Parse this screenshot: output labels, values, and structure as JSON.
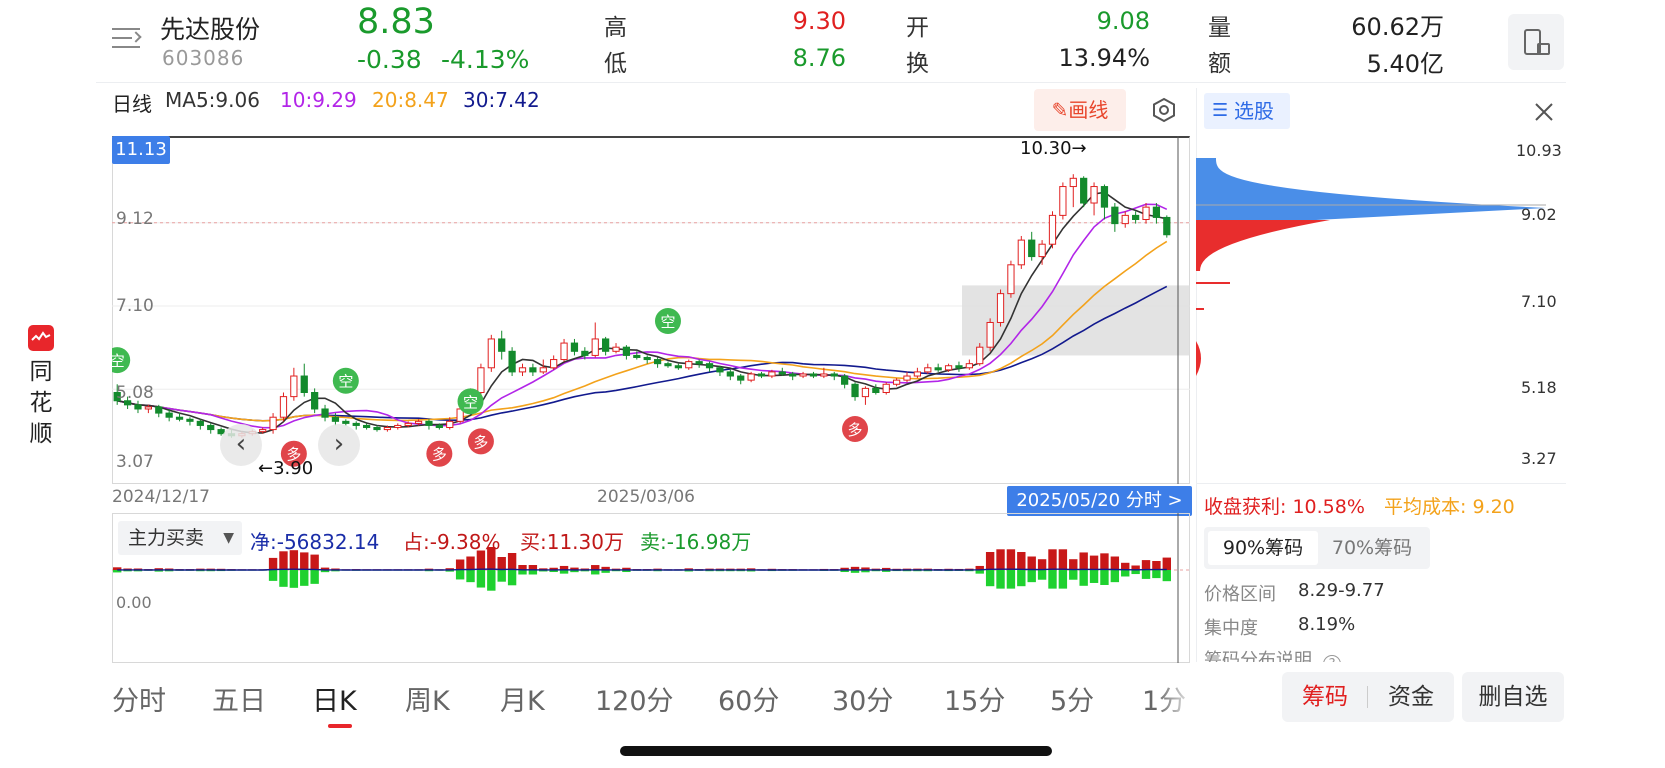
{
  "header": {
    "stock_name": "先达股份",
    "stock_code": "603086",
    "price": "8.83",
    "change": "-0.38",
    "change_pct": "-4.13%",
    "high_label": "高",
    "high_value": "9.30",
    "low_label": "低",
    "low_value": "8.76",
    "open_label": "开",
    "open_value": "9.08",
    "turnover_label": "换",
    "turnover_value": "13.94%",
    "volume_label": "量",
    "volume_value": "60.62万",
    "amount_label": "额",
    "amount_value": "5.40亿"
  },
  "brand": {
    "chars": [
      "同",
      "花",
      "顺"
    ]
  },
  "ma_bar": {
    "period": "日线",
    "ma5": "MA5:9.06",
    "ma10": "10:9.29",
    "ma20": "20:8.47",
    "ma30": "30:7.42",
    "draw_button": "画线"
  },
  "kline": {
    "top_price_tag": "11.13",
    "y_labels": [
      "9.12",
      "7.10",
      "5.08",
      "3.07"
    ],
    "x_dates": [
      "2024/12/17",
      "2025/03/06"
    ],
    "date_tag": "2025/05/20 分时 >",
    "high_annotation": "10.30→",
    "low_annotation": "←3.90",
    "signal_short": "空",
    "signal_long": "多",
    "colors": {
      "up": "#e02020",
      "down": "#138a2c",
      "ma5": "#333333",
      "ma10": "#b225e8",
      "ma20": "#f3a21b",
      "ma30": "#121a8e"
    }
  },
  "indicator": {
    "name": "主力买卖",
    "zero_label": "0.00",
    "net": "净:-56832.14",
    "share": "占:-9.38%",
    "buy": "买:11.30万",
    "sell": "卖:-16.98万"
  },
  "chip_panel": {
    "select_button": "选股",
    "price_labels": [
      "10.93",
      "9.02",
      "7.10",
      "5.18",
      "3.27"
    ],
    "profit_label": "收盘获利: 10.58%",
    "avg_cost_label": "平均成本: 9.20",
    "tab_90": "90%筹码",
    "tab_70": "70%筹码",
    "range_label": "价格区间",
    "range_value": "8.29-9.77",
    "concentration_label": "集中度",
    "concentration_value": "8.19%",
    "help_label": "筹码分布说明"
  },
  "periods": [
    "分时",
    "五日",
    "日K",
    "周K",
    "月K",
    "120分",
    "60分",
    "30分",
    "15分",
    "5分",
    "1分"
  ],
  "active_period": "日K",
  "bottom_buttons": {
    "chips": "筹码",
    "funds": "资金",
    "remove": "删自选"
  },
  "kline_data": {
    "ohlc": [
      [
        5.0,
        4.8,
        5.2,
        4.7
      ],
      [
        4.8,
        4.7,
        4.9,
        4.6
      ],
      [
        4.7,
        4.6,
        4.8,
        4.5
      ],
      [
        4.6,
        4.65,
        4.7,
        4.5
      ],
      [
        4.65,
        4.5,
        4.7,
        4.4
      ],
      [
        4.5,
        4.4,
        4.6,
        4.3
      ],
      [
        4.4,
        4.35,
        4.5,
        4.3
      ],
      [
        4.35,
        4.3,
        4.4,
        4.2
      ],
      [
        4.3,
        4.2,
        4.35,
        4.1
      ],
      [
        4.2,
        4.1,
        4.25,
        4.0
      ],
      [
        4.1,
        4.0,
        4.15,
        3.95
      ],
      [
        4.0,
        3.95,
        4.1,
        3.9
      ],
      [
        3.95,
        4.0,
        4.05,
        3.9
      ],
      [
        4.0,
        4.05,
        4.1,
        3.95
      ],
      [
        4.05,
        4.1,
        4.15,
        4.0
      ],
      [
        4.1,
        4.4,
        4.5,
        4.0
      ],
      [
        4.4,
        4.9,
        5.0,
        4.3
      ],
      [
        4.9,
        5.4,
        5.6,
        4.8
      ],
      [
        5.4,
        5.0,
        5.7,
        4.9
      ],
      [
        5.0,
        4.6,
        5.1,
        4.5
      ],
      [
        4.6,
        4.4,
        4.7,
        4.3
      ],
      [
        4.4,
        4.3,
        4.5,
        4.2
      ],
      [
        4.3,
        4.25,
        4.35,
        4.2
      ],
      [
        4.25,
        4.2,
        4.3,
        4.1
      ],
      [
        4.2,
        4.15,
        4.25,
        4.1
      ],
      [
        4.15,
        4.1,
        4.2,
        4.05
      ],
      [
        4.1,
        4.15,
        4.2,
        4.05
      ],
      [
        4.15,
        4.2,
        4.25,
        4.1
      ],
      [
        4.2,
        4.25,
        4.3,
        4.15
      ],
      [
        4.25,
        4.3,
        4.35,
        4.2
      ],
      [
        4.3,
        4.2,
        4.35,
        4.1
      ],
      [
        4.2,
        4.15,
        4.25,
        4.1
      ],
      [
        4.15,
        4.3,
        4.4,
        4.1
      ],
      [
        4.3,
        4.6,
        4.7,
        4.25
      ],
      [
        4.6,
        5.0,
        5.1,
        4.55
      ],
      [
        5.0,
        5.6,
        5.7,
        4.95
      ],
      [
        5.6,
        6.3,
        6.4,
        5.5
      ],
      [
        6.3,
        6.0,
        6.5,
        5.8
      ],
      [
        6.0,
        5.5,
        6.1,
        5.4
      ],
      [
        5.5,
        5.6,
        5.7,
        5.4
      ],
      [
        5.6,
        5.5,
        5.7,
        5.4
      ],
      [
        5.5,
        5.6,
        5.8,
        5.45
      ],
      [
        5.6,
        5.8,
        5.9,
        5.55
      ],
      [
        5.8,
        6.2,
        6.3,
        5.75
      ],
      [
        6.2,
        6.0,
        6.3,
        5.9
      ],
      [
        6.0,
        5.9,
        6.1,
        5.8
      ],
      [
        5.9,
        6.3,
        6.7,
        5.85
      ],
      [
        6.3,
        6.0,
        6.35,
        5.9
      ],
      [
        6.0,
        6.1,
        6.2,
        5.95
      ],
      [
        6.1,
        5.9,
        6.15,
        5.8
      ],
      [
        5.9,
        5.85,
        6.0,
        5.8
      ],
      [
        5.85,
        5.8,
        5.9,
        5.7
      ],
      [
        5.8,
        5.7,
        5.85,
        5.6
      ],
      [
        5.7,
        5.65,
        5.75,
        5.6
      ],
      [
        5.65,
        5.6,
        5.7,
        5.55
      ],
      [
        5.6,
        5.75,
        5.8,
        5.55
      ],
      [
        5.75,
        5.7,
        5.8,
        5.6
      ],
      [
        5.7,
        5.6,
        5.75,
        5.5
      ],
      [
        5.6,
        5.5,
        5.65,
        5.4
      ],
      [
        5.5,
        5.4,
        5.55,
        5.3
      ],
      [
        5.4,
        5.3,
        5.45,
        5.2
      ],
      [
        5.3,
        5.45,
        5.5,
        5.25
      ],
      [
        5.45,
        5.4,
        5.5,
        5.35
      ],
      [
        5.4,
        5.5,
        5.55,
        5.35
      ],
      [
        5.5,
        5.45,
        5.6,
        5.4
      ],
      [
        5.45,
        5.4,
        5.5,
        5.3
      ],
      [
        5.4,
        5.45,
        5.5,
        5.35
      ],
      [
        5.45,
        5.4,
        5.5,
        5.35
      ],
      [
        5.4,
        5.45,
        5.6,
        5.35
      ],
      [
        5.45,
        5.4,
        5.5,
        5.3
      ],
      [
        5.4,
        5.2,
        5.45,
        5.1
      ],
      [
        5.2,
        4.9,
        5.25,
        4.8
      ],
      [
        4.9,
        5.1,
        5.15,
        4.7
      ],
      [
        5.1,
        5.0,
        5.2,
        4.95
      ],
      [
        5.0,
        5.2,
        5.25,
        4.95
      ],
      [
        5.2,
        5.3,
        5.35,
        5.15
      ],
      [
        5.3,
        5.4,
        5.5,
        5.25
      ],
      [
        5.4,
        5.5,
        5.6,
        5.35
      ],
      [
        5.5,
        5.6,
        5.7,
        5.45
      ],
      [
        5.6,
        5.55,
        5.7,
        5.5
      ],
      [
        5.55,
        5.65,
        5.7,
        5.5
      ],
      [
        5.65,
        5.6,
        5.75,
        5.5
      ],
      [
        5.6,
        5.7,
        5.8,
        5.55
      ],
      [
        5.7,
        6.1,
        6.2,
        5.65
      ],
      [
        6.1,
        6.7,
        6.8,
        6.0
      ],
      [
        6.7,
        7.4,
        7.5,
        6.6
      ],
      [
        7.4,
        8.1,
        8.2,
        7.3
      ],
      [
        8.1,
        8.7,
        8.8,
        8.0
      ],
      [
        8.7,
        8.3,
        8.9,
        8.2
      ],
      [
        8.3,
        8.6,
        8.7,
        8.1
      ],
      [
        8.6,
        9.3,
        9.4,
        8.5
      ],
      [
        9.3,
        10.0,
        10.1,
        9.2
      ],
      [
        10.0,
        10.2,
        10.3,
        9.5
      ],
      [
        10.2,
        9.6,
        10.25,
        9.5
      ],
      [
        9.6,
        10.0,
        10.1,
        9.3
      ],
      [
        10.0,
        9.5,
        10.05,
        9.2
      ],
      [
        9.5,
        9.1,
        9.6,
        8.9
      ],
      [
        9.1,
        9.3,
        9.4,
        9.0
      ],
      [
        9.3,
        9.2,
        9.4,
        9.1
      ],
      [
        9.2,
        9.5,
        9.6,
        9.1
      ],
      [
        9.5,
        9.25,
        9.6,
        9.1
      ],
      [
        9.25,
        8.83,
        9.3,
        8.76
      ]
    ]
  }
}
